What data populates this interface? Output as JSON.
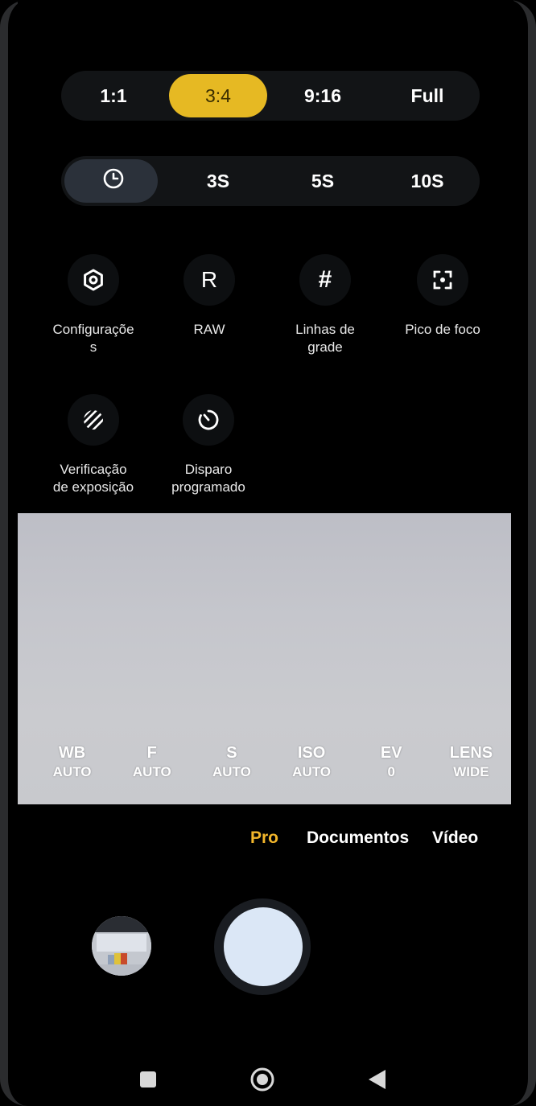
{
  "aspect_ratio": {
    "options": [
      "1:1",
      "3:4",
      "9:16",
      "Full"
    ],
    "selected": "3:4",
    "selected_color": "#e6b923"
  },
  "timer": {
    "off_icon": "clock-icon",
    "options": [
      "3S",
      "5S",
      "10S"
    ],
    "selected": "off"
  },
  "quick_settings": [
    {
      "icon": "gear-icon",
      "label": "Configuraçõe\ns"
    },
    {
      "icon": "raw-r-icon",
      "label": "RAW"
    },
    {
      "icon": "grid-hash-icon",
      "label": "Linhas de\ngrade"
    },
    {
      "icon": "focus-peaking-icon",
      "label": "Pico de foco"
    },
    {
      "icon": "zebra-stripes-icon",
      "label": "Verificação\nde exposição"
    },
    {
      "icon": "interval-timer-icon",
      "label": "Disparo\nprogramado"
    }
  ],
  "pro_controls": [
    {
      "key": "WB",
      "value": "AUTO"
    },
    {
      "key": "F",
      "value": "AUTO"
    },
    {
      "key": "S",
      "value": "AUTO"
    },
    {
      "key": "ISO",
      "value": "AUTO"
    },
    {
      "key": "EV",
      "value": "0"
    },
    {
      "key": "LENS",
      "value": "WIDE"
    }
  ],
  "modes": {
    "items": [
      "Pro",
      "Documentos",
      "Vídeo"
    ],
    "active": "Pro",
    "active_color": "#f2b62b"
  },
  "bottom_controls": {
    "gallery_icon": "gallery-thumbnail",
    "shutter_icon": "shutter-button"
  },
  "nav_bar": [
    "recents-square-icon",
    "home-circle-icon",
    "back-triangle-icon"
  ]
}
